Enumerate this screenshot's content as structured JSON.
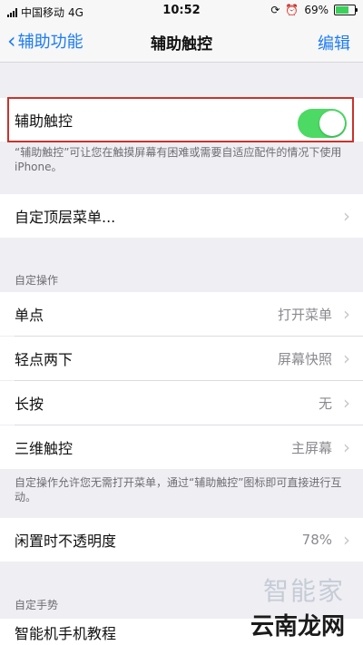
{
  "statusbar": {
    "carrier": "中国移动",
    "network": "4G",
    "time": "10:52",
    "battery_percent": "69%",
    "battery_level": 0.69
  },
  "navbar": {
    "back_label": "辅助功能",
    "title": "辅助触控",
    "edit_label": "编辑"
  },
  "assistive_touch": {
    "label": "辅助触控",
    "enabled": true,
    "footnote": "“辅助触控”可让您在触摸屏幕有困难或需要自适应配件的情况下使用 iPhone。"
  },
  "top_menu": {
    "label": "自定顶层菜单..."
  },
  "custom_actions": {
    "caption": "自定操作",
    "items": [
      {
        "label": "单点",
        "value": "打开菜单"
      },
      {
        "label": "轻点两下",
        "value": "屏幕快照"
      },
      {
        "label": "长按",
        "value": "无"
      },
      {
        "label": "三维触控",
        "value": "主屏幕"
      }
    ],
    "footnote": "自定操作允许您无需打开菜单，通过“辅助触控”图标即可直接进行互动。"
  },
  "idle_opacity": {
    "label": "闲置时不透明度",
    "value": "78%"
  },
  "custom_gestures": {
    "caption": "自定手势"
  },
  "partial_row": {
    "label": "智能机手机教程"
  },
  "watermark": {
    "top": "智能家",
    "bottom": "云南龙网"
  },
  "colors": {
    "accent": "#1f7cf2",
    "toggle_on": "#4cd964",
    "highlight": "#c9332c"
  }
}
